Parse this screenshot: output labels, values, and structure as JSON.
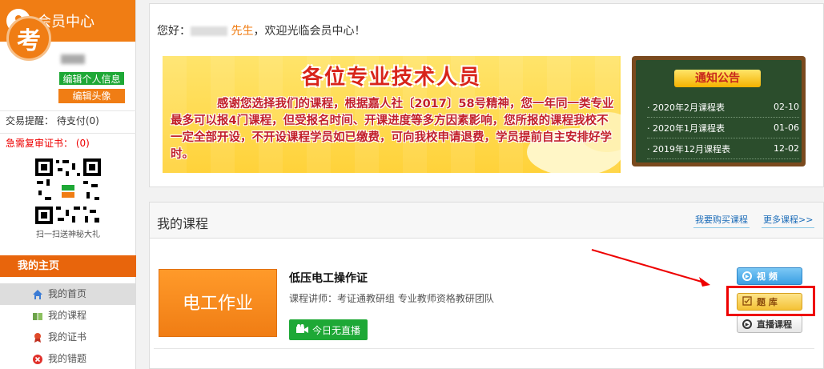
{
  "sidebar": {
    "title": "会员中心",
    "avatar_char": "考",
    "edit_info_label": "编辑个人信息",
    "edit_avatar_label": "编辑头像",
    "trade_reminder": "交易提醒：  待支付(0)",
    "urgent_review": "急需复审证书：  (0)",
    "qr_caption": "扫一扫送神秘大礼",
    "home_section": "我的主页",
    "nav": [
      {
        "label": "我的首页",
        "icon": "home-icon"
      },
      {
        "label": "我的课程",
        "icon": "book-icon"
      },
      {
        "label": "我的证书",
        "icon": "badge-icon"
      },
      {
        "label": "我的错题",
        "icon": "x-circle-icon"
      }
    ]
  },
  "greeting": {
    "prefix": "您好：",
    "suffix_name": "先生",
    "welcome": "，欢迎光临会员中心！"
  },
  "banner": {
    "title": "各位专业技术人员",
    "text": "感谢您选择我们的课程，根据嘉人社〔2017〕58号精神，您一年同一类专业最多可以报4门课程，但受报名时间、开课进度等多方因素影响，您所报的课程我校不一定全部开设，不开设课程学员如已缴费，可向我校申请退费，学员提前自主安排好学时。"
  },
  "notices": {
    "title": "通知公告",
    "items": [
      {
        "label": "· 2020年2月课程表",
        "date": "02-10"
      },
      {
        "label": "· 2020年1月课程表",
        "date": "01-06"
      },
      {
        "label": "· 2019年12月课程表",
        "date": "12-02"
      }
    ]
  },
  "courses": {
    "title": "我的课程",
    "buy_link": "我要购买课程",
    "more_link": "更多课程>>",
    "item": {
      "thumb_text": "电工作业",
      "name": "低压电工操作证",
      "teacher": "课程讲师：考证通教研组 专业教师资格教研团队",
      "live_label": "今日无直播",
      "video_label": "视 频",
      "bank_label": "题 库",
      "live_course_label": "直播课程"
    }
  },
  "colors": {
    "accent": "#f07d14",
    "green": "#1ea836",
    "highlight": "#e00000"
  }
}
